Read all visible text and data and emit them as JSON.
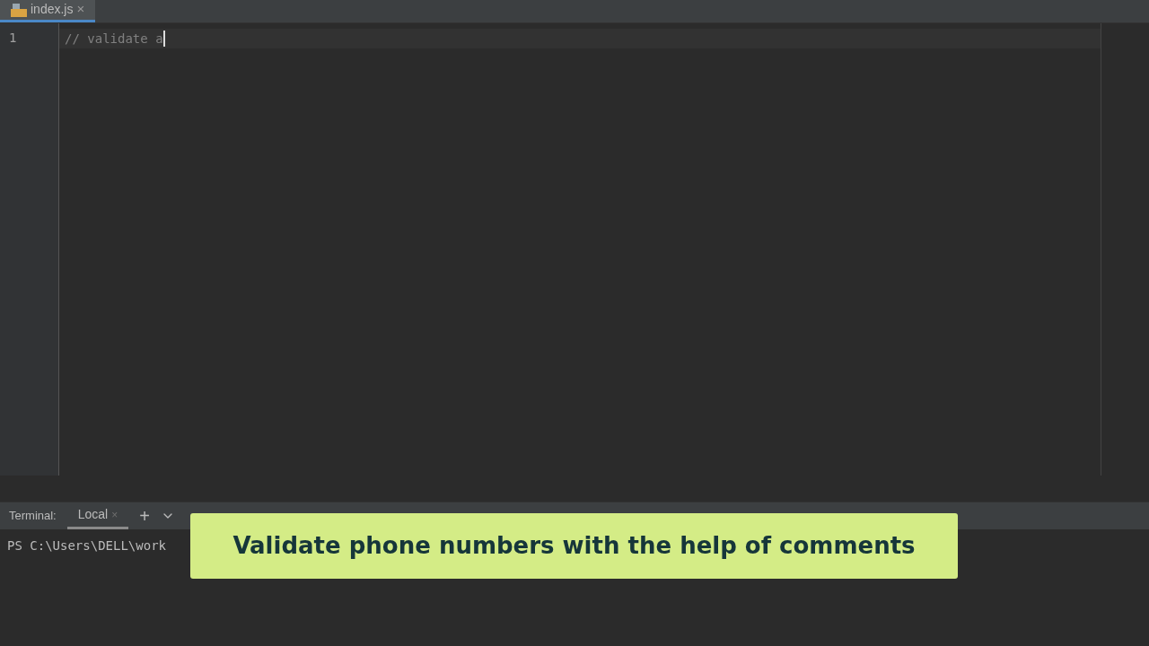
{
  "editor_tabs": [
    {
      "label": "index.js",
      "selected": true,
      "close": "×"
    }
  ],
  "editor": {
    "lines": [
      {
        "number": "1",
        "text": "// validate a",
        "cursor": true
      }
    ]
  },
  "terminal": {
    "title": "Terminal:",
    "tabs": [
      {
        "label": "Local",
        "selected": true,
        "close": "×"
      }
    ],
    "new_tab": "+",
    "prompt": "PS C:\\Users\\DELL\\work"
  },
  "caption": "Validate phone numbers with the help of comments"
}
